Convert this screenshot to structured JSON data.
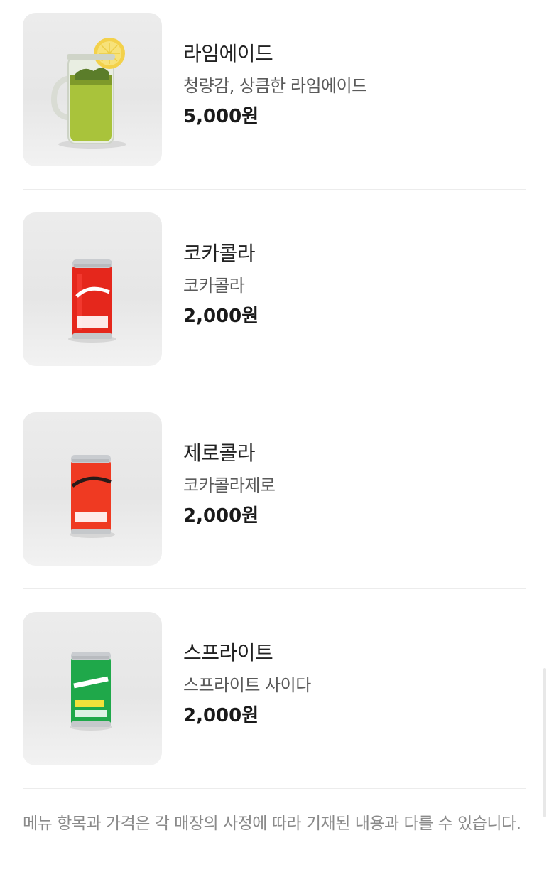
{
  "menu": {
    "items": [
      {
        "name": "라임에이드",
        "description": "청량감, 상큼한 라임에이드",
        "price": "5,000원",
        "image": "limeade-jar-photo"
      },
      {
        "name": "코카콜라",
        "description": "코카콜라",
        "price": "2,000원",
        "image": "coca-cola-can-photo"
      },
      {
        "name": "제로콜라",
        "description": "코카콜라제로",
        "price": "2,000원",
        "image": "coca-cola-zero-can-photo"
      },
      {
        "name": "스프라이트",
        "description": "스프라이트 사이다",
        "price": "2,000원",
        "image": "sprite-can-photo"
      }
    ]
  },
  "notice": {
    "text": "메뉴 항목과 가격은 각 매장의 사정에 따라 기재된 내용과 다를 수 있습니다."
  },
  "colors": {
    "text_primary": "#222222",
    "text_secondary": "#5a5a5a",
    "notice_text": "#8a8a8a",
    "divider": "#ececec",
    "coke_red": "#e8251b",
    "sprite_green": "#1fa84a",
    "limeade_green": "#a8c23a"
  }
}
